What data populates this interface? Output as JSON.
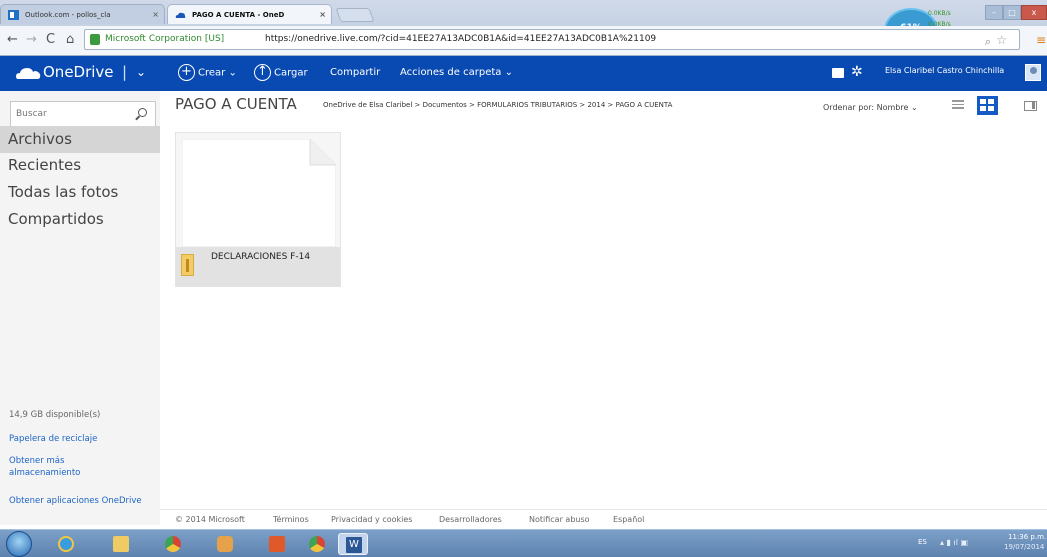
{
  "browser": {
    "tabs": [
      {
        "label": "Outlook.com - pollos_cla",
        "close": "×"
      },
      {
        "label": "PAGO A CUENTA - OneD",
        "close": "×"
      }
    ],
    "net_meter": {
      "percent": "61%",
      "up": "0.0KB/s",
      "down": "0.0KB/s"
    },
    "nav": {
      "back": "←",
      "forward": "→",
      "reload": "C",
      "home": "⌂"
    },
    "address": {
      "identity": "Microsoft Corporation [US]",
      "url": "https://onedrive.live.com/?cid=41EE27A13ADC0B1A&id=41EE27A13ADC0B1A%21109"
    },
    "window_controls": {
      "minimize": "–",
      "maximize": "□",
      "close": "x"
    }
  },
  "header": {
    "brand": "OneDrive",
    "separator": "|",
    "chevron": "⌄",
    "commands": {
      "crear": "Crear ⌄",
      "cargar": "Cargar",
      "compartir": "Compartir",
      "acciones": "Acciones de carpeta ⌄"
    },
    "create_icon": "+",
    "upload_icon": "↑",
    "user_name": "Elsa Claribel Castro Chinchilla"
  },
  "sidebar": {
    "search_placeholder": "Buscar",
    "items": [
      "Archivos",
      "Recientes",
      "Todas las fotos",
      "Compartidos"
    ],
    "storage": "14,9 GB disponible(s)",
    "recycle": "Papelera de reciclaje",
    "more_storage": "Obtener más almacenamiento",
    "get_apps": "Obtener aplicaciones OneDrive"
  },
  "main": {
    "title": "PAGO A CUENTA",
    "breadcrumb": "OneDrive de Elsa Claribel > Documentos > FORMULARIOS TRIBUTARIOS > 2014 > PAGO A CUENTA",
    "sort": "Ordenar por: Nombre ⌄",
    "folders": [
      {
        "name": "DECLARACIONES F-14"
      }
    ]
  },
  "footer": [
    "© 2014 Microsoft",
    "Términos",
    "Privacidad y cookies",
    "Desarrolladores",
    "Notificar abuso",
    "Español"
  ],
  "taskbar": {
    "word_glyph": "W",
    "tray_lang": "ES",
    "tray_icons": "▴ ▮ ıl ▣",
    "time": "11:36 p.m.",
    "date": "19/07/2014"
  },
  "colors": {
    "onedrive_blue": "#094ab2",
    "link_blue": "#1c64c4",
    "selected_nav": "#d5d5d5"
  }
}
